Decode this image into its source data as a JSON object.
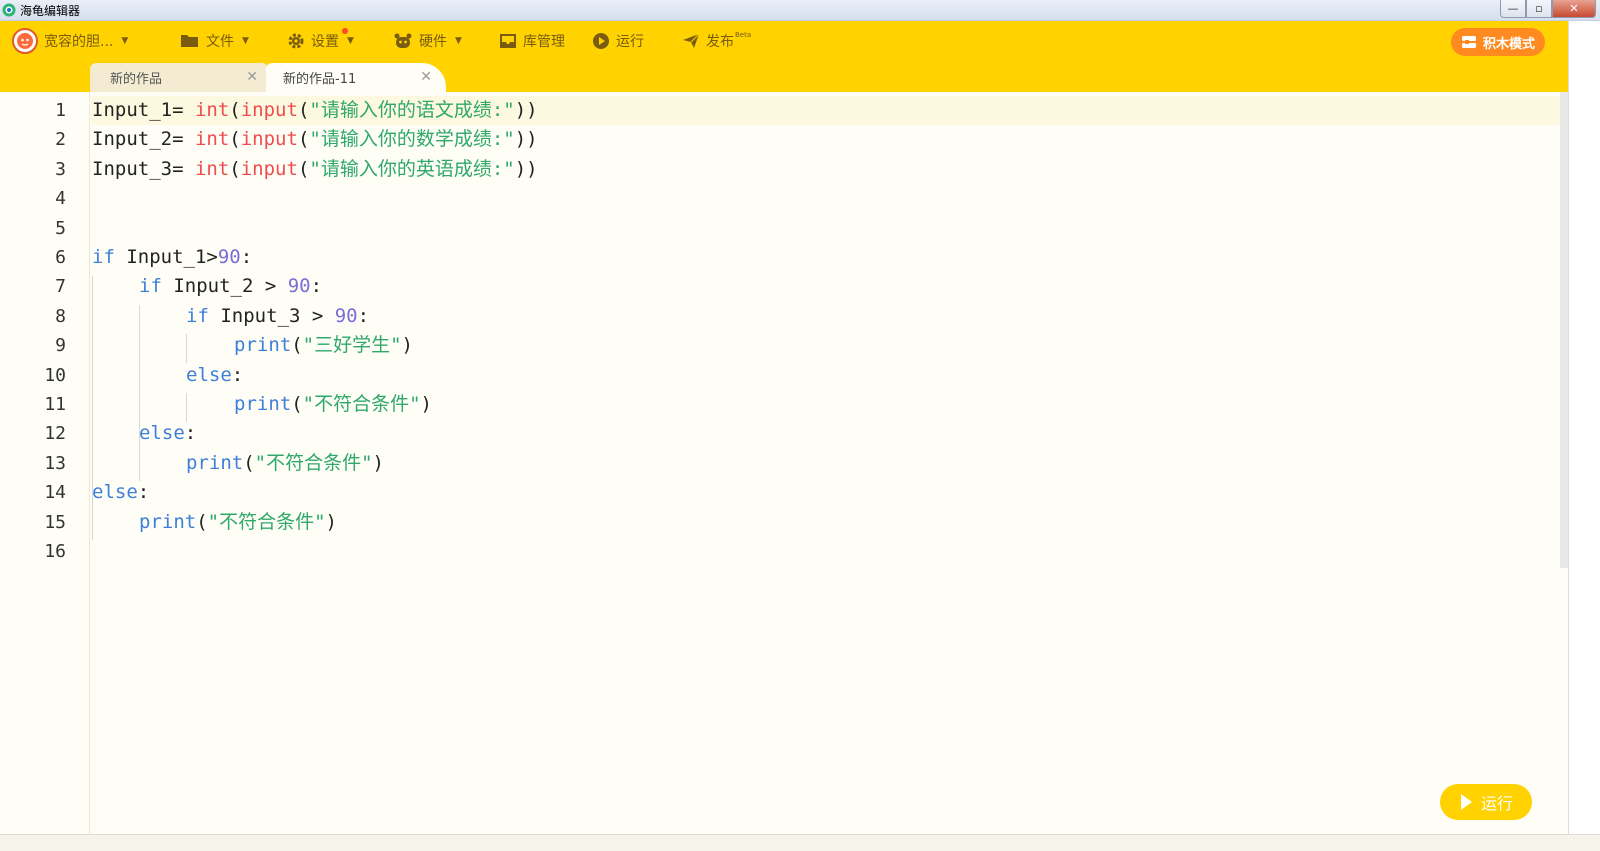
{
  "window": {
    "title": "海龟编辑器",
    "controls": {
      "minimize": "—",
      "restore": "▫",
      "close": "✕"
    }
  },
  "toolbar": {
    "user_name": "宽容的胆...",
    "file": "文件",
    "settings": "设置",
    "hardware": "硬件",
    "library": "库管理",
    "run": "运行",
    "publish": "发布",
    "publish_badge": "Beta",
    "block_mode": "积木模式"
  },
  "tabs": [
    {
      "label": "新的作品",
      "close": "✕"
    },
    {
      "label": "新的作品-11",
      "close": "✕"
    }
  ],
  "editor": {
    "line_numbers": [
      "1",
      "2",
      "3",
      "4",
      "5",
      "6",
      "7",
      "8",
      "9",
      "10",
      "11",
      "12",
      "13",
      "14",
      "15",
      "16"
    ],
    "code": {
      "l1_var": "Input_1= ",
      "l1_int": "int",
      "l1_p1": "(",
      "l1_input": "input",
      "l1_p2": "(",
      "l1_str": "\"请输入你的语文成绩:\"",
      "l1_p3": "))",
      "l2_var": "Input_2= ",
      "l2_int": "int",
      "l2_p1": "(",
      "l2_input": "input",
      "l2_p2": "(",
      "l2_str": "\"请输入你的数学成绩:\"",
      "l2_p3": "))",
      "l3_var": "Input_3= ",
      "l3_int": "int",
      "l3_p1": "(",
      "l3_input": "input",
      "l3_p2": "(",
      "l3_str": "\"请输入你的英语成绩:\"",
      "l3_p3": "))",
      "l6_if": "if",
      "l6_cond": " Input_1>",
      "l6_num": "90",
      "l6_colon": ":",
      "l7_if": "if",
      "l7_cond": " Input_2 > ",
      "l7_num": "90",
      "l7_colon": ":",
      "l8_if": "if",
      "l8_cond": " Input_3 > ",
      "l8_num": "90",
      "l8_colon": ":",
      "l9_print": "print",
      "l9_p1": "(",
      "l9_str": "\"三好学生\"",
      "l9_p2": ")",
      "l10_else": "else",
      "l10_colon": ":",
      "l11_print": "print",
      "l11_p1": "(",
      "l11_str": "\"不符合条件\"",
      "l11_p2": ")",
      "l12_else": "else",
      "l12_colon": ":",
      "l13_print": "print",
      "l13_p1": "(",
      "l13_str": "\"不符合条件\"",
      "l13_p2": ")",
      "l14_else": "else",
      "l14_colon": ":",
      "l15_print": "print",
      "l15_p1": "(",
      "l15_str": "\"不符合条件\"",
      "l15_p2": ")"
    }
  },
  "run_button": {
    "label": "运行"
  },
  "colors": {
    "toolbar_bg": "#ffd200",
    "keyword": "#3d7fd9",
    "builtin_red": "#ee4d4d",
    "string": "#2fa86a",
    "number": "#7b6cd6",
    "block_mode_button": "#ff8a1f"
  }
}
